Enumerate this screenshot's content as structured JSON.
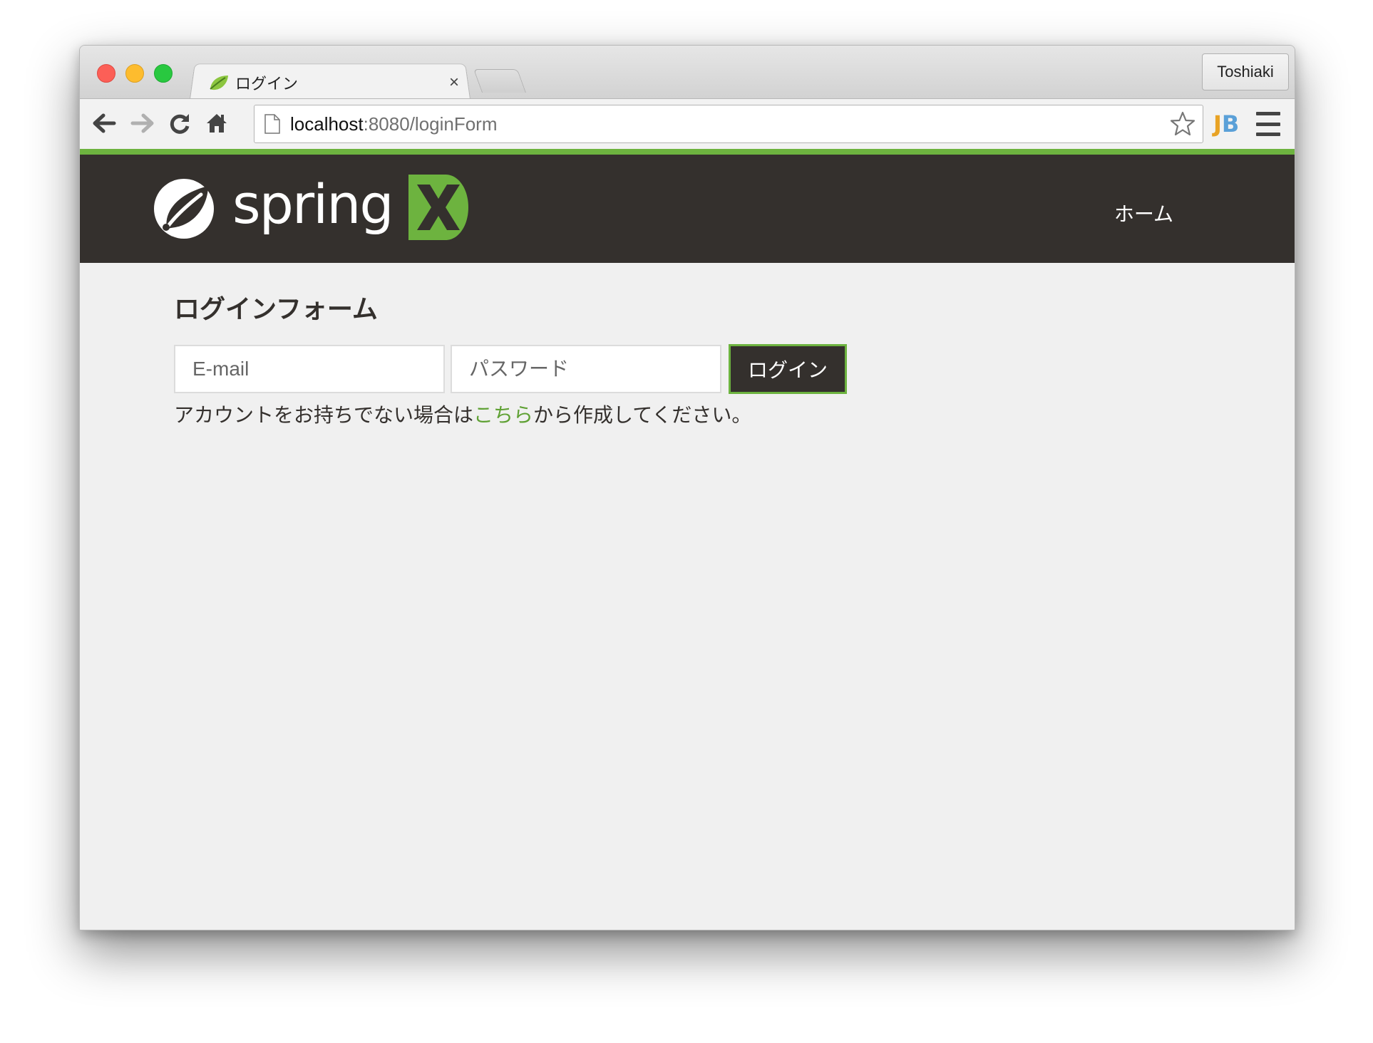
{
  "browser": {
    "tab_title": "ログイン",
    "tab_close": "×",
    "profile_name": "Toshiaki",
    "url_host": "localhost",
    "url_rest": ":8080/loginForm",
    "extension_label_j": "J",
    "extension_label_b": "B"
  },
  "header": {
    "logo_text": "spring",
    "nav_home": "ホーム",
    "accent_color": "#6db33f",
    "background_color": "#34302d"
  },
  "login_form": {
    "title": "ログインフォーム",
    "email_placeholder": "E-mail",
    "password_placeholder": "パスワード",
    "submit_label": "ログイン",
    "register_prefix": "アカウントをお持ちでない場合は",
    "register_link": "こちら",
    "register_suffix": "から作成してください。"
  },
  "icons": [
    "back-arrow-icon",
    "forward-arrow-icon",
    "reload-icon",
    "home-icon",
    "page-icon",
    "star-icon",
    "menu-icon",
    "spring-leaf-icon",
    "x-logo-icon"
  ]
}
